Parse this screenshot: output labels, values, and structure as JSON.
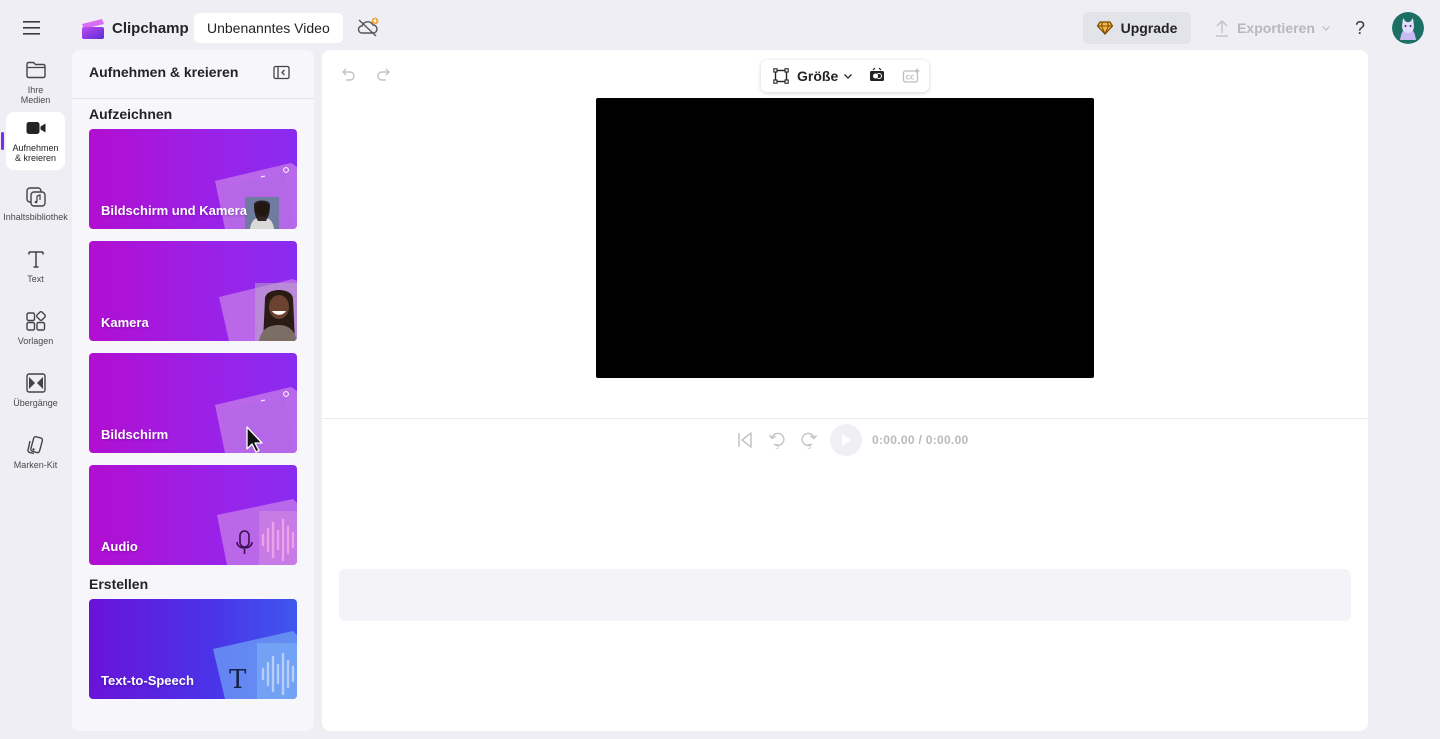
{
  "topbar": {
    "brand": "Clipchamp",
    "video_title": "Unbenanntes Video",
    "upgrade_label": "Upgrade",
    "export_label": "Exportieren",
    "help_label": "?"
  },
  "rail": {
    "items": [
      {
        "label": "Ihre\nMedien",
        "icon": "folder-icon"
      },
      {
        "label": "Aufnehmen\n& kreieren",
        "icon": "video-camera-icon"
      },
      {
        "label": "Inhaltsbibliothek",
        "icon": "content-library-icon"
      },
      {
        "label": "Text",
        "icon": "text-icon"
      },
      {
        "label": "Vorlagen",
        "icon": "templates-icon"
      },
      {
        "label": "Übergänge",
        "icon": "transitions-icon"
      },
      {
        "label": "Marken-Kit",
        "icon": "brand-kit-icon"
      }
    ]
  },
  "panel": {
    "title": "Aufnehmen & kreieren",
    "section_record": "Aufzeichnen",
    "section_create": "Erstellen",
    "cards": [
      {
        "label": "Bildschirm und Kamera"
      },
      {
        "label": "Kamera"
      },
      {
        "label": "Bildschirm"
      },
      {
        "label": "Audio"
      },
      {
        "label": "Text-to-Speech"
      }
    ]
  },
  "editor": {
    "size_label": "Größe",
    "time_current": "0:00.00",
    "time_separator": " / ",
    "time_total": "0:00.00"
  },
  "colors": {
    "accent": "#7b2cf2",
    "card_gradient_start": "#b20ed1",
    "card_gradient_end": "#8a2cf0",
    "tts_gradient_end": "#3f57ee"
  }
}
